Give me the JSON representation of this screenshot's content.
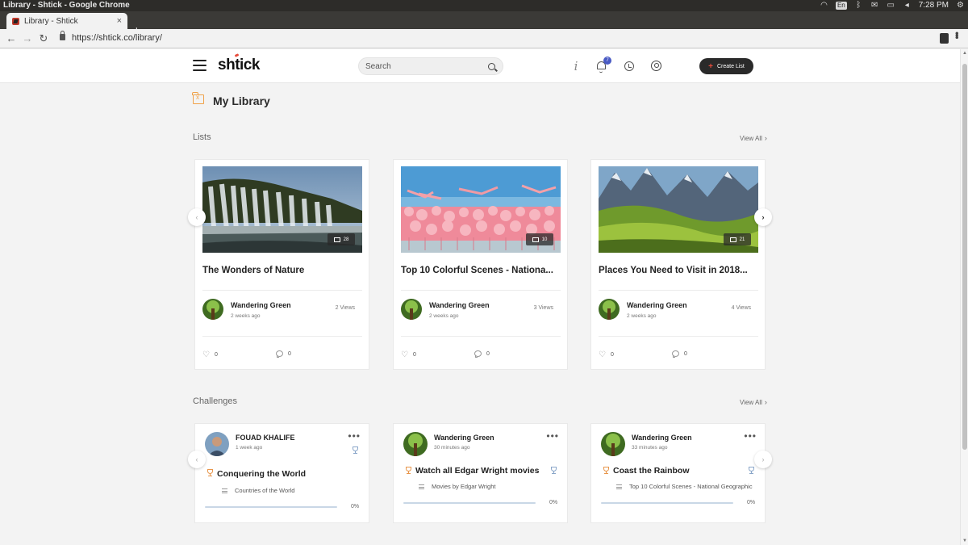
{
  "os": {
    "window_title": "Library - Shtick - Google Chrome",
    "lang": "En",
    "clock": "7:28 PM"
  },
  "browser": {
    "tab_title": "Library - Shtick",
    "tab_close": "×",
    "new_tab": "+",
    "url": "https://shtick.co/library/",
    "back": "←",
    "forward": "→",
    "reload": "↻"
  },
  "header": {
    "logo_pre": "sh",
    "logo_tick": "t",
    "logo_post": "ick",
    "search_placeholder": "Search",
    "info_glyph": "i",
    "notification_count": "7",
    "create_label": "Create List",
    "create_glyph": "+"
  },
  "page": {
    "title": "My Library"
  },
  "lists_section": {
    "title": "Lists",
    "view_all": "View All",
    "chevron": "›",
    "prev": "‹",
    "next": "›",
    "cards": [
      {
        "title": "The Wonders of Nature",
        "image_count": "28",
        "author": "Wandering Green",
        "time": "2 weeks ago",
        "views": "2 Views",
        "likes": "0",
        "comments": "0"
      },
      {
        "title": "Top 10 Colorful Scenes - Nationa...",
        "image_count": "10",
        "author": "Wandering Green",
        "time": "2 weeks ago",
        "views": "3 Views",
        "likes": "0",
        "comments": "0"
      },
      {
        "title": "Places You Need to Visit in 2018...",
        "image_count": "21",
        "author": "Wandering Green",
        "time": "2 weeks ago",
        "views": "4 Views",
        "likes": "0",
        "comments": "0"
      }
    ]
  },
  "challenges_section": {
    "title": "Challenges",
    "view_all": "View All",
    "chevron": "›",
    "prev": "‹",
    "next": "›",
    "menu_glyph": "•••",
    "cards": [
      {
        "author": "FOUAD KHALIFE",
        "time": "1 week ago",
        "title": "Conquering the World",
        "list": "Countries of the World",
        "progress_pct": "0%",
        "progress": 0
      },
      {
        "author": "Wandering Green",
        "time": "30 minutes ago",
        "title": "Watch all Edgar Wright movies",
        "list": "Movies by Edgar Wright",
        "progress_pct": "0%",
        "progress": 0
      },
      {
        "author": "Wandering Green",
        "time": "33 minutes ago",
        "title": "Coast the Rainbow",
        "list": "Top 10 Colorful Scenes - National Geographic",
        "progress_pct": "0%",
        "progress": 0
      }
    ]
  },
  "colors": {
    "accent": "#e74c3c",
    "badge": "#4a5bc4",
    "library_icon": "#f0a24a",
    "trophy_orange": "#e8964b",
    "trophy_blue": "#8aa6c9"
  }
}
